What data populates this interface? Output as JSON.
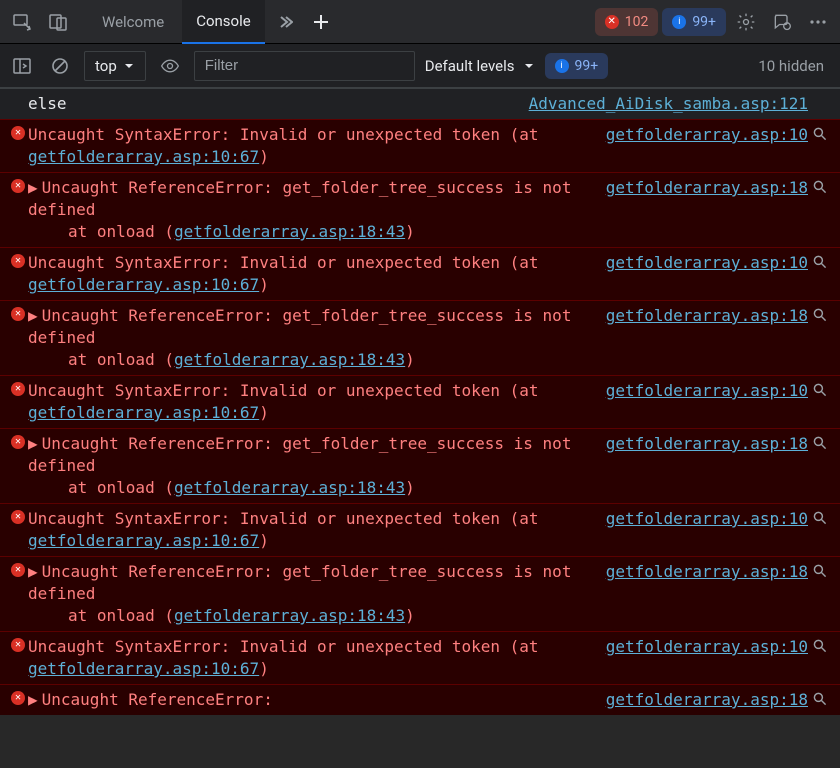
{
  "tabs": {
    "welcome": "Welcome",
    "console": "Console"
  },
  "badges": {
    "errors": "102",
    "info_top": "99+",
    "issues": "99+"
  },
  "filterbar": {
    "context": "top",
    "filter_placeholder": "Filter",
    "levels": "Default levels",
    "hidden": "10 hidden"
  },
  "messages": [
    {
      "type": "log",
      "text": "else",
      "source": "Advanced_AiDisk_samba.asp:121"
    },
    {
      "type": "error",
      "text_a": "Uncaught SyntaxError: Invalid or unexpected token (at ",
      "link": "getfolderarray.asp:10:67",
      "text_b": ")",
      "source": "getfolderarray.asp:10"
    },
    {
      "type": "error_ref",
      "line1": "Uncaught ReferenceError: get_folder_tree_success is not defined",
      "stack_pre": "at onload (",
      "stack_link": "getfolderarray.asp:18:43",
      "stack_post": ")",
      "source": "getfolderarray.asp:18"
    },
    {
      "type": "error",
      "text_a": "Uncaught SyntaxError: Invalid or unexpected token (at ",
      "link": "getfolderarray.asp:10:67",
      "text_b": ")",
      "source": "getfolderarray.asp:10"
    },
    {
      "type": "error_ref",
      "line1": "Uncaught ReferenceError: get_folder_tree_success is not defined",
      "stack_pre": "at onload (",
      "stack_link": "getfolderarray.asp:18:43",
      "stack_post": ")",
      "source": "getfolderarray.asp:18"
    },
    {
      "type": "error",
      "text_a": "Uncaught SyntaxError: Invalid or unexpected token (at ",
      "link": "getfolderarray.asp:10:67",
      "text_b": ")",
      "source": "getfolderarray.asp:10"
    },
    {
      "type": "error_ref",
      "line1": "Uncaught ReferenceError: get_folder_tree_success is not defined",
      "stack_pre": "at onload (",
      "stack_link": "getfolderarray.asp:18:43",
      "stack_post": ")",
      "source": "getfolderarray.asp:18"
    },
    {
      "type": "error",
      "text_a": "Uncaught SyntaxError: Invalid or unexpected token (at ",
      "link": "getfolderarray.asp:10:67",
      "text_b": ")",
      "source": "getfolderarray.asp:10"
    },
    {
      "type": "error_ref",
      "line1": "Uncaught ReferenceError: get_folder_tree_success is not defined",
      "stack_pre": "at onload (",
      "stack_link": "getfolderarray.asp:18:43",
      "stack_post": ")",
      "source": "getfolderarray.asp:18"
    },
    {
      "type": "error",
      "text_a": "Uncaught SyntaxError: Invalid or unexpected token (at ",
      "link": "getfolderarray.asp:10:67",
      "text_b": ")",
      "source": "getfolderarray.asp:10"
    },
    {
      "type": "error_ref_short",
      "line1": "Uncaught ReferenceError:",
      "source": "getfolderarray.asp:18"
    }
  ]
}
